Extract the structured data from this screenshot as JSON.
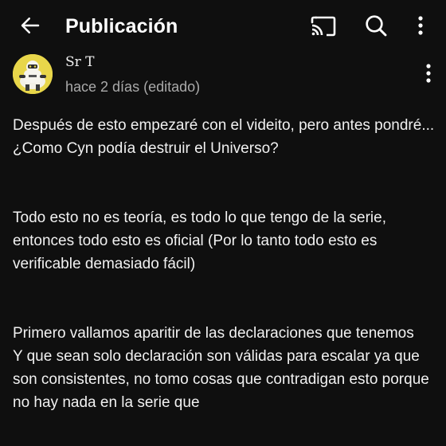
{
  "app_bar": {
    "title": "Publicación",
    "icons": {
      "back": "arrow-left-icon",
      "cast": "cast-icon",
      "search": "search-icon",
      "more": "more-vertical-icon"
    }
  },
  "post": {
    "author": "Sr T",
    "meta": "hace 2 días (editado)",
    "paragraphs": [
      "Después de esto empezaré con el videito, pero antes pondré...\n¿Como Cyn podía destruir el Universo?",
      "Todo esto no es teoría, es todo lo que tengo de la serie, entonces todo esto es oficial (Por lo tanto todo esto es verificable demasiado fácil)",
      "Primero vallamos aparitir de las declaraciones que tenemos\nY que sean solo declaración son válidas para escalar ya que son consistentes, no tomo cosas que contradigan esto porque no hay nada en la serie que"
    ]
  },
  "colors": {
    "background": "#0f0f0f",
    "text": "#f1f1f1",
    "secondary_text": "#aaaaaa",
    "avatar_bg": "#e8d64a"
  }
}
